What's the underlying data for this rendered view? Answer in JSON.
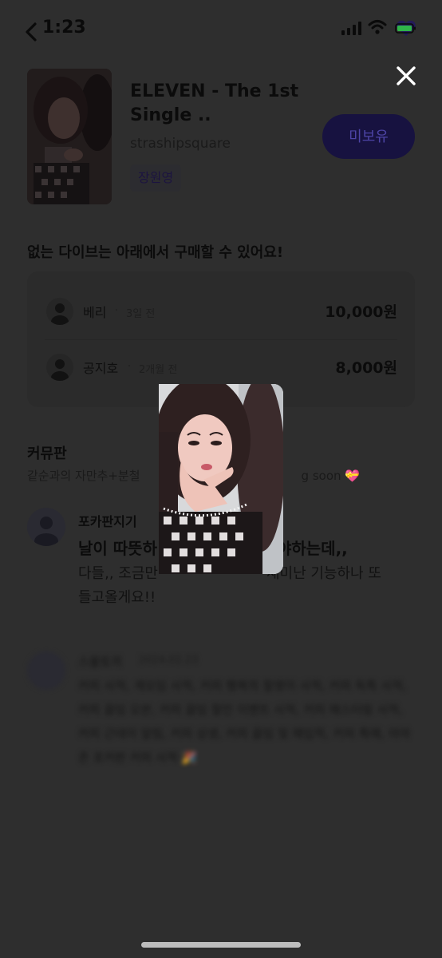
{
  "status_bar": {
    "time": "1:23",
    "icons": [
      "chevron-left-icon",
      "signal-icon",
      "wifi-icon",
      "battery-icon"
    ]
  },
  "close_icon": "close-icon",
  "product": {
    "title": "ELEVEN - The 1st Single ..",
    "seller": "strashipsquare",
    "member_tag": "장원영",
    "own_button": "미보유"
  },
  "sellers": {
    "heading": "없는 다이브는 아래에서 구매할 수 있어요!",
    "rows": [
      {
        "name": "베리",
        "dot": "·",
        "time": "3일 전",
        "price": "10,000원"
      },
      {
        "name": "공지호",
        "dot": "·",
        "time": "2개월 전",
        "price": "8,000원"
      }
    ]
  },
  "community": {
    "title": "커뮤판",
    "subtitle_start": "같순과의 자만추+분철",
    "subtitle_end": "g soon",
    "subtitle_emoji": "💝"
  },
  "post": {
    "author": "포카판지기",
    "title_start": "날이 따뜻하",
    "title_end": "야하는데,,",
    "body_start": "다들,, 조금만",
    "body_end": "재미난 기능하나 또",
    "body_line2": "들고올게요!!"
  },
  "blurred_post": {
    "author": "스물토끼",
    "date": "2024.02.23",
    "body": "커피 사적, 계모임 사적, 커피 행복의 찰영이 사적, 커피 독특 사적, 커피 끓임 오븐, 커피 끓임 찰인 이벤트 사적, 커피 매스터링 사적, 커피 근데이 알림, 커피 상생, 커피 끓임 및 매입픽, 커피 특매, 아마존 포커판 커피 사적 🎉"
  },
  "colors": {
    "overlay": "#2e2e2e",
    "accent_button": "#171240",
    "accent_text": "#4d44a6",
    "battery_green": "#2fb44a",
    "heart_indigo": "#241a5a",
    "home_indicator": "#bdbdbd"
  }
}
